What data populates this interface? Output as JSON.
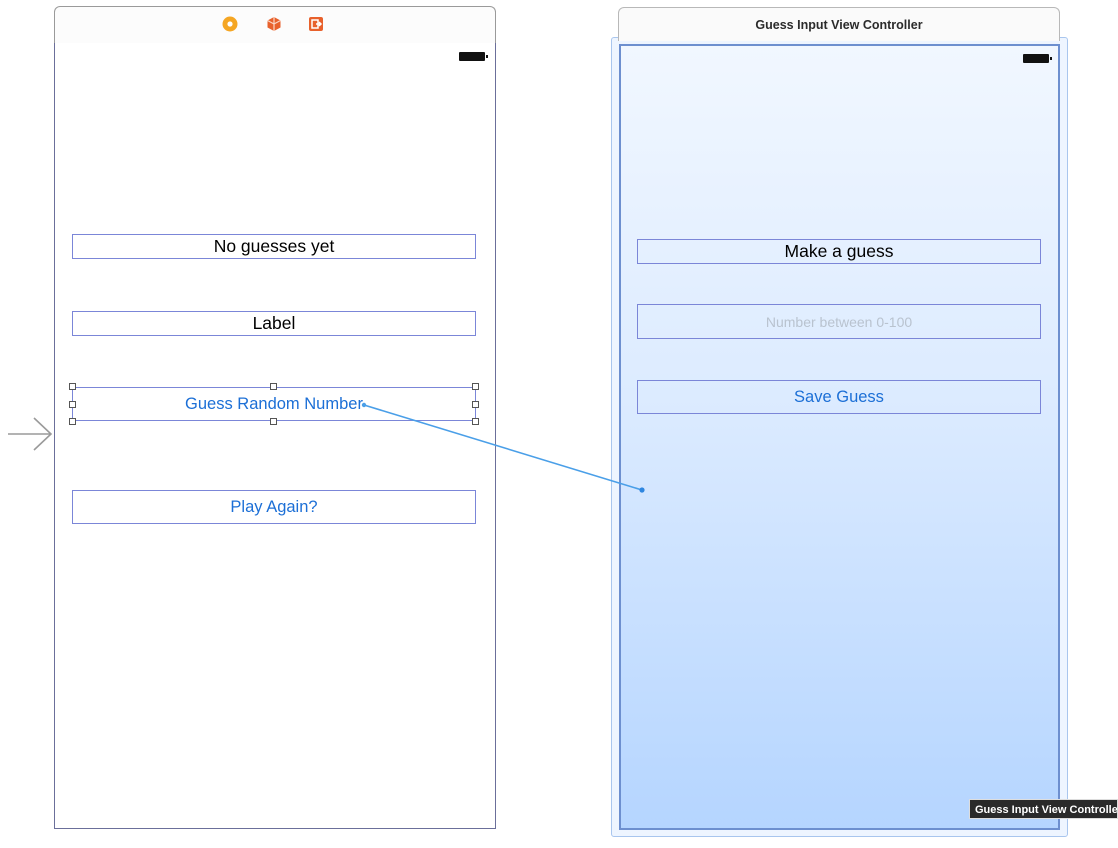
{
  "left_scene": {
    "toolbar_icons": [
      {
        "icon": "view-controller-icon",
        "color": "#f5a623"
      },
      {
        "icon": "first-responder-icon",
        "color": "#e8612c"
      },
      {
        "icon": "exit-icon",
        "color": "#e8612c"
      }
    ],
    "label_no_guesses": "No guesses yet",
    "label_generic": "Label",
    "button_guess_random": "Guess Random Number",
    "button_play_again": "Play Again?"
  },
  "right_scene": {
    "title": "Guess Input View Controller",
    "label_make_guess": "Make a guess",
    "textfield_placeholder": "Number between 0-100",
    "button_save_guess": "Save Guess",
    "tooltip": "Guess Input View Controller"
  },
  "colors": {
    "button_text": "#1c6fd6",
    "segue_line": "#4a9fe8",
    "selection_border": "#7b86d8"
  }
}
